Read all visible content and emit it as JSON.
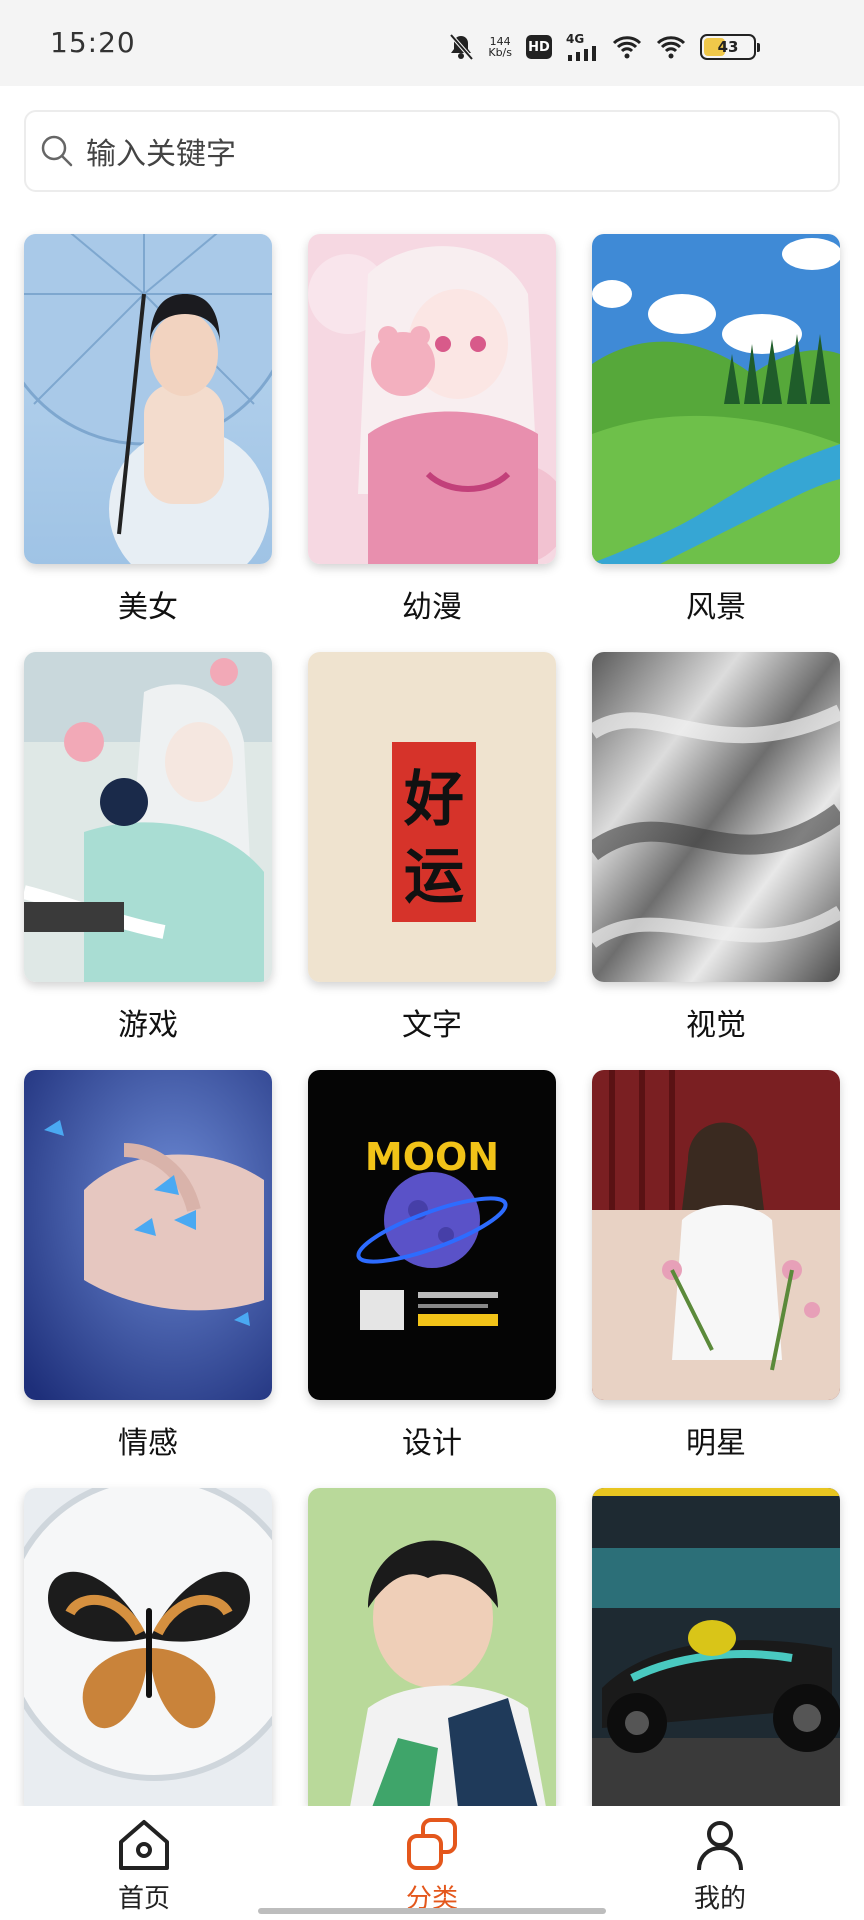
{
  "status_bar": {
    "time": "15:20",
    "net_speed_value": "144",
    "net_speed_unit": "Kb/s",
    "hd_label": "HD",
    "network_type": "4G",
    "battery_level": "43",
    "battery_fraction": 0.43,
    "icons": [
      "mute-bell-icon",
      "hd-icon",
      "cellular-signal-icon",
      "wifi-icon",
      "wifi-icon",
      "battery-icon"
    ]
  },
  "search": {
    "placeholder": "输入关键字",
    "icon": "search-icon"
  },
  "categories": [
    {
      "label": "美女",
      "image": "woman-with-umbrella"
    },
    {
      "label": "幼漫",
      "image": "anime-girl-with-bear"
    },
    {
      "label": "风景",
      "image": "green-valley-river"
    },
    {
      "label": "游戏",
      "image": "anime-game-character"
    },
    {
      "label": "文字",
      "image": "good-luck-calligraphy",
      "image_text": "好运"
    },
    {
      "label": "视觉",
      "image": "silver-fabric"
    },
    {
      "label": "情感",
      "image": "hands-with-butterflies"
    },
    {
      "label": "设计",
      "image": "moon-poster",
      "image_text": "MOON"
    },
    {
      "label": "明星",
      "image": "celebrity-with-flowers"
    },
    {
      "label": "",
      "image": "butterfly"
    },
    {
      "label": "",
      "image": "boy-portrait"
    },
    {
      "label": "",
      "image": "race-car"
    }
  ],
  "bottom_nav": {
    "items": [
      {
        "label": "首页",
        "icon": "home-icon",
        "active": false
      },
      {
        "label": "分类",
        "icon": "category-icon",
        "active": true
      },
      {
        "label": "我的",
        "icon": "profile-icon",
        "active": false
      }
    ]
  },
  "colors": {
    "accent": "#e4571c",
    "battery": "#f0c84a",
    "status_bar_bg": "#f4f4f4"
  }
}
